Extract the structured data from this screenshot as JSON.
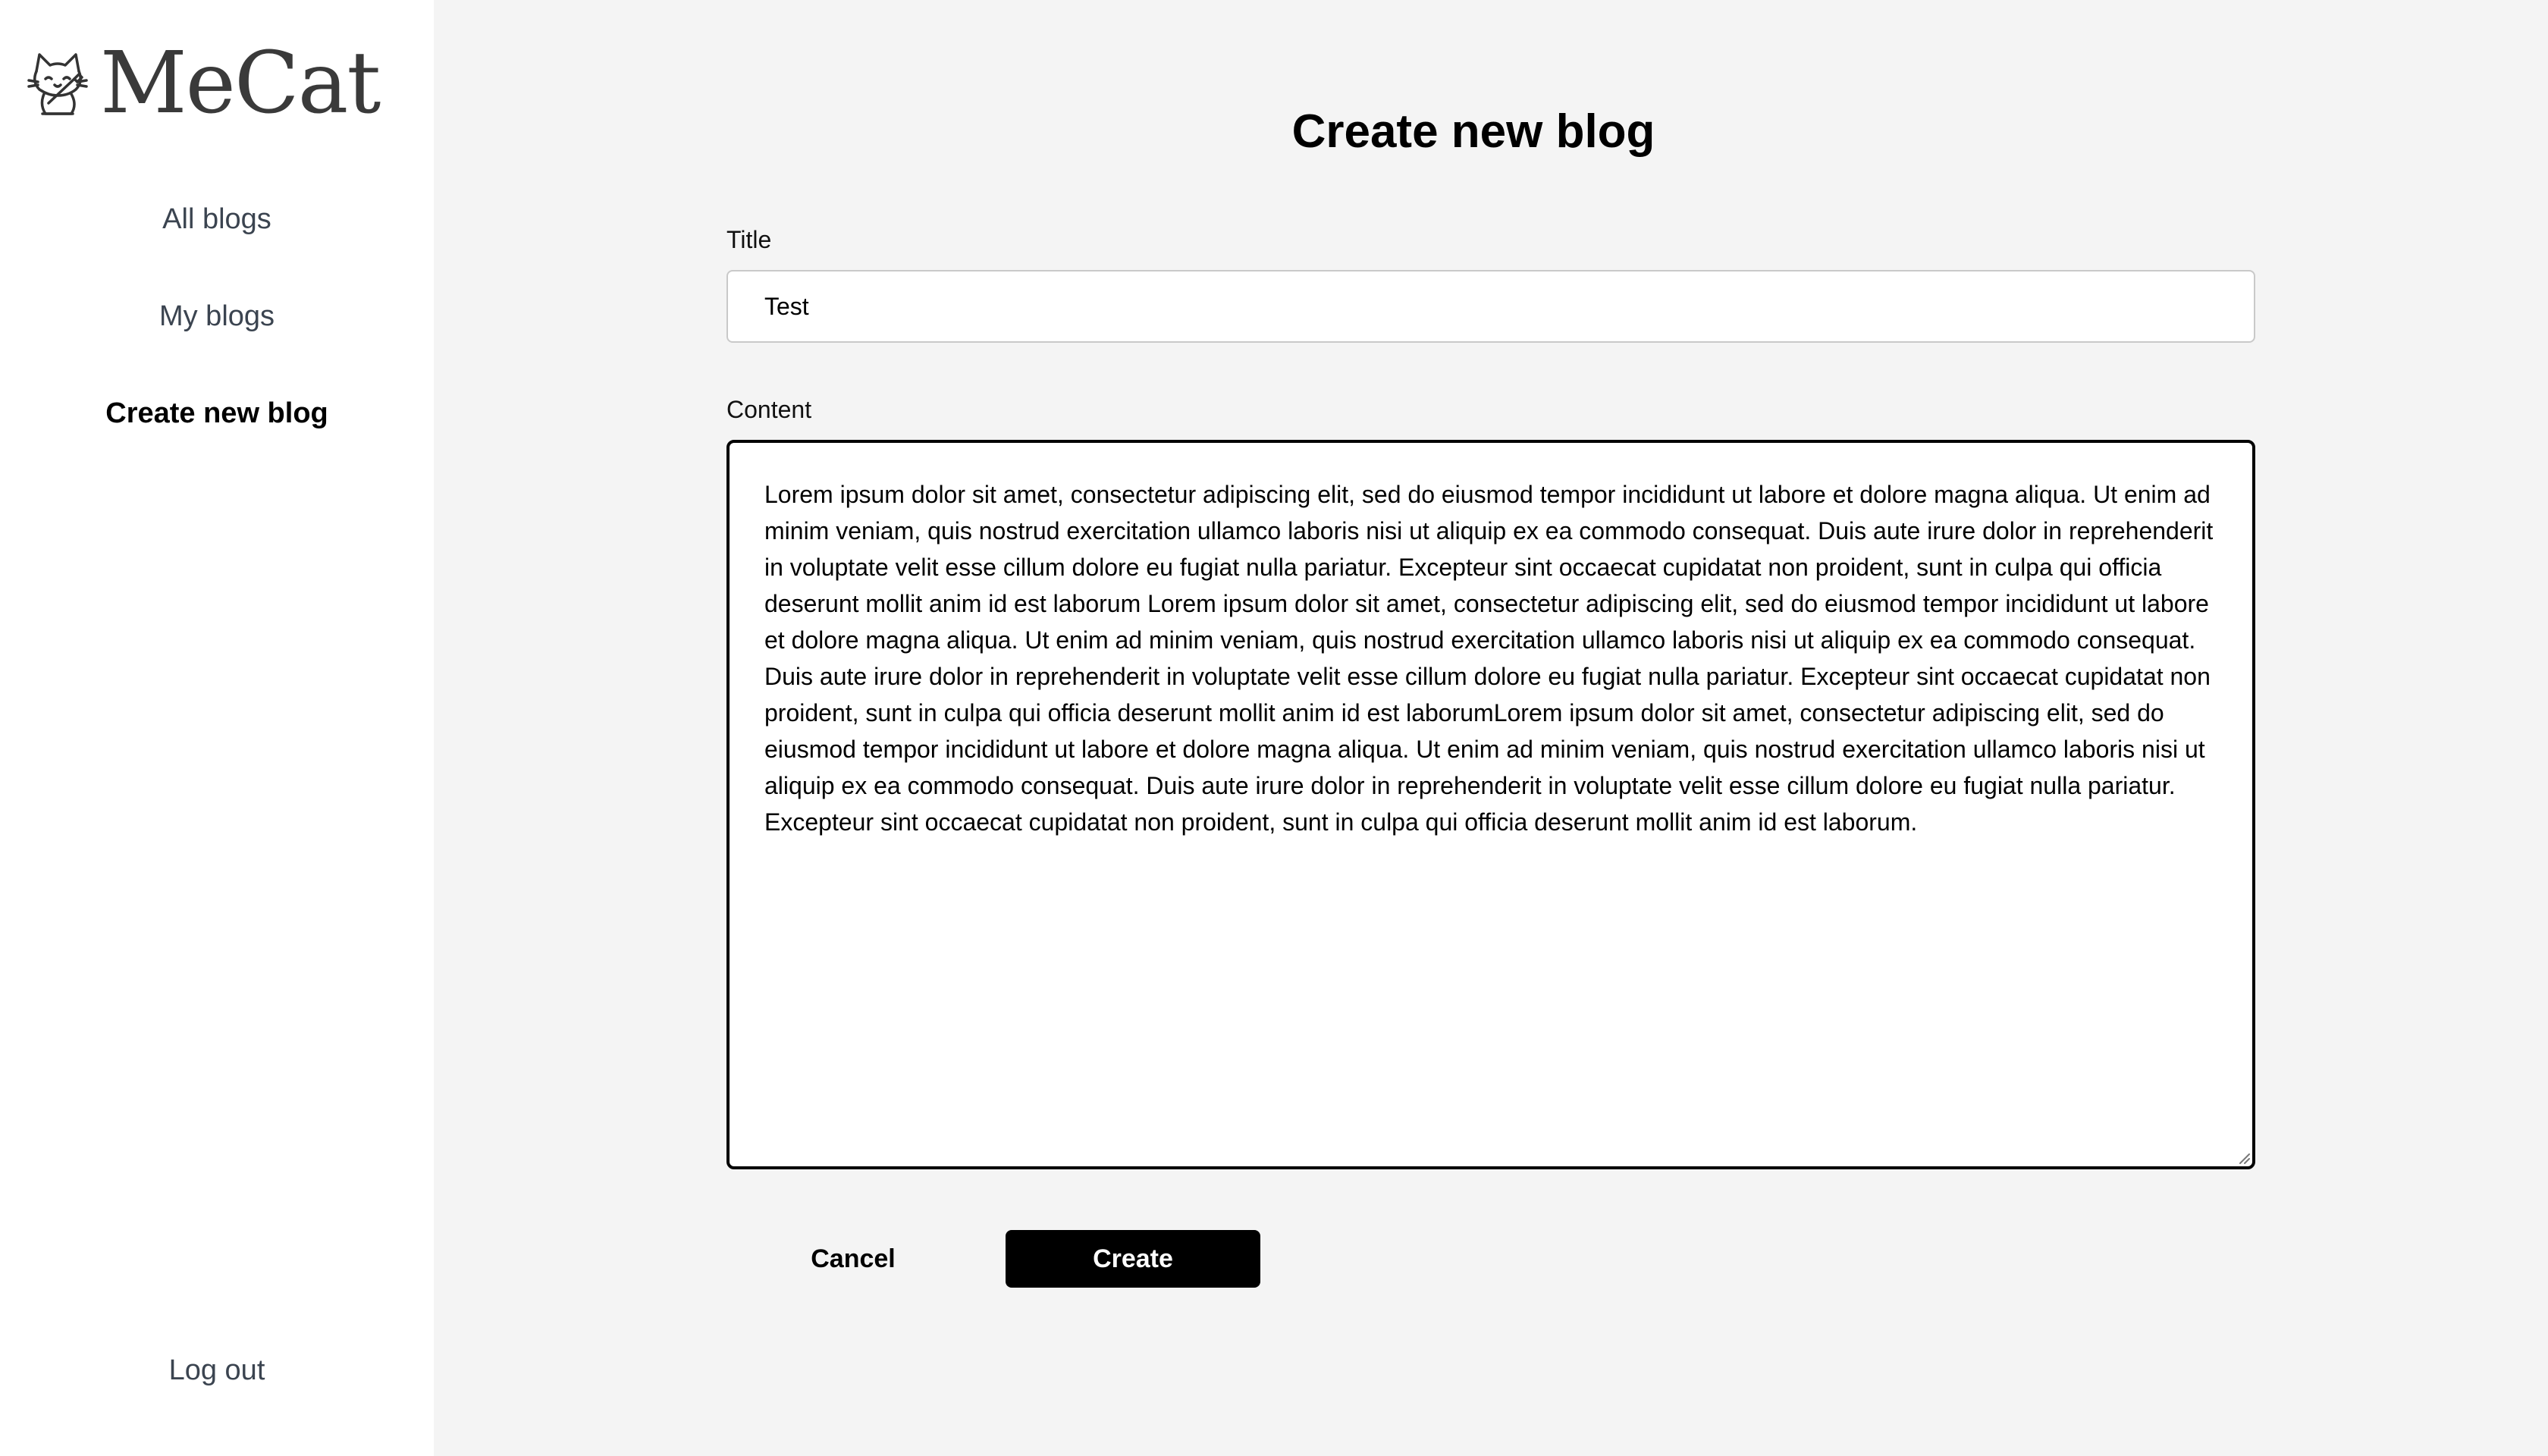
{
  "sidebar": {
    "brand": "MeCat",
    "logo_icon": "cat-writing-icon",
    "nav": {
      "all_blogs": "All blogs",
      "my_blogs": "My blogs",
      "create_new_blog": "Create new blog"
    },
    "logout": "Log out"
  },
  "main": {
    "title": "Create new blog",
    "form": {
      "title_label": "Title",
      "title_value": "Test",
      "content_label": "Content",
      "content_value": "Lorem ipsum dolor sit amet, consectetur adipiscing elit, sed do eiusmod tempor incididunt ut labore et dolore magna aliqua. Ut enim ad minim veniam, quis nostrud exercitation ullamco laboris nisi ut aliquip ex ea commodo consequat. Duis aute irure dolor in reprehenderit in voluptate velit esse cillum dolore eu fugiat nulla pariatur. Excepteur sint occaecat cupidatat non proident, sunt in culpa qui officia deserunt mollit anim id est laborum Lorem ipsum dolor sit amet, consectetur adipiscing elit, sed do eiusmod tempor incididunt ut labore et dolore magna aliqua. Ut enim ad minim veniam, quis nostrud exercitation ullamco laboris nisi ut aliquip ex ea commodo consequat. Duis aute irure dolor in reprehenderit in voluptate velit esse cillum dolore eu fugiat nulla pariatur. Excepteur sint occaecat cupidatat non proident, sunt in culpa qui officia deserunt mollit anim id est laborumLorem ipsum dolor sit amet, consectetur adipiscing elit, sed do eiusmod tempor incididunt ut labore et dolore magna aliqua. Ut enim ad minim veniam, quis nostrud exercitation ullamco laboris nisi ut aliquip ex ea commodo consequat. Duis aute irure dolor in reprehenderit in voluptate velit esse cillum dolore eu fugiat nulla pariatur. Excepteur sint occaecat cupidatat non proident, sunt in culpa qui officia deserunt mollit anim id est laborum.",
      "cancel_label": "Cancel",
      "create_label": "Create"
    }
  },
  "colors": {
    "sidebar_bg": "#ffffff",
    "main_bg": "#f4f4f4",
    "primary_button": "#000000",
    "nav_text": "#3b4450"
  }
}
